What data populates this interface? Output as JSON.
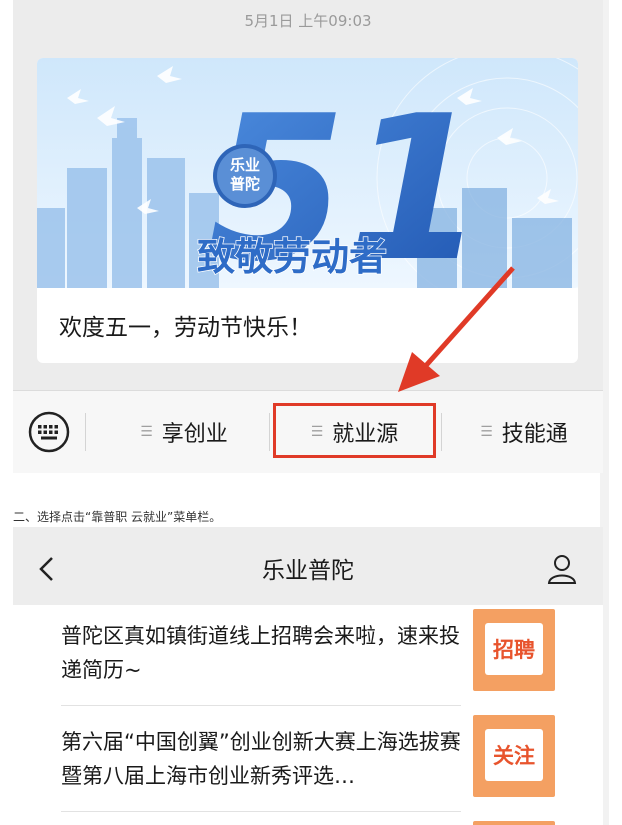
{
  "top_screen": {
    "timestamp": "5月1日 上午09:03",
    "banner": {
      "logo_line1": "乐业",
      "logo_line2": "普陀",
      "big_number": "51",
      "slogan": "致敬劳动者"
    },
    "card_title": "欢度五一，劳动节快乐！",
    "menu": {
      "items": [
        "享创业",
        "就业源",
        "技能通"
      ],
      "highlighted_index": 1
    }
  },
  "caption": "二、选择点击“靠普职 云就业”菜单栏。",
  "bottom_screen": {
    "nav_title": "乐业普陀",
    "articles": [
      {
        "title": "普陀区真如镇街道线上招聘会来啦，速来投递简历~",
        "thumb_text": "招聘"
      },
      {
        "title": "第六届“中国创翼”创业创新大赛上海选拔赛暨第八届上海市创业新秀评选…",
        "thumb_text": "关注"
      }
    ]
  },
  "colors": {
    "highlight": "#e03a27",
    "thumb_orange": "#f4a062",
    "banner_blue": "#2f6fc8"
  }
}
